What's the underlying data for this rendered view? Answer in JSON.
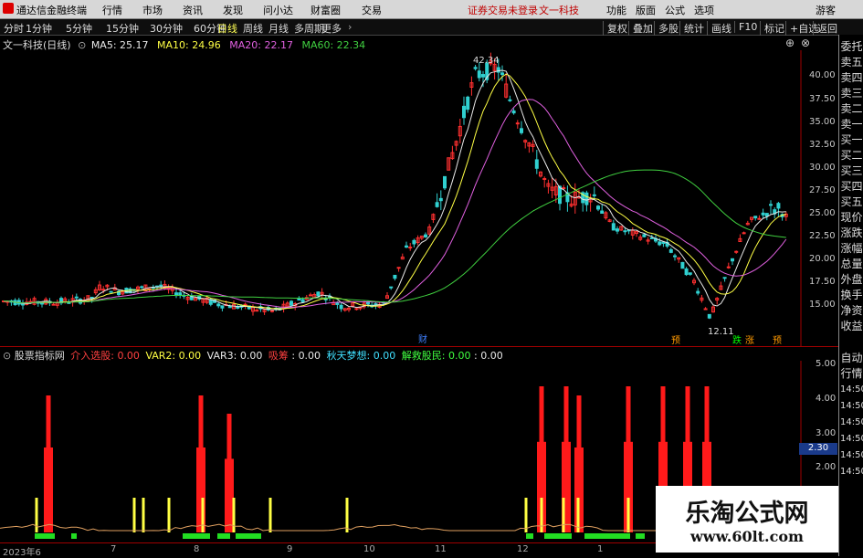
{
  "menu": {
    "app_name": "通达信金融终端",
    "items": [
      "行情",
      "市场",
      "资讯",
      "发现",
      "问小达",
      "财富圈",
      "交易"
    ],
    "notice": "证券交易未登录",
    "stock_name": "文一科技",
    "right_items": [
      "功能",
      "版面",
      "公式",
      "选项",
      "游客"
    ]
  },
  "toolbar": {
    "periods": [
      "1分钟",
      "5分钟",
      "15分钟",
      "30分钟",
      "60分钟"
    ],
    "first": "分时",
    "active": "日线",
    "others": [
      "周线",
      "月线",
      "多周期",
      "更多"
    ],
    "right": [
      "复权",
      "叠加",
      "多股",
      "统计",
      "画线",
      "F10",
      "标记",
      "+自选",
      "返回"
    ]
  },
  "main_chart": {
    "title": "文一科技(日线)",
    "ma": [
      {
        "label": "MA5: 25.17",
        "color": "#e8e8e8"
      },
      {
        "label": "MA10: 24.96",
        "color": "#ffff44"
      },
      {
        "label": "MA20: 22.17",
        "color": "#e060e0"
      },
      {
        "label": "MA60: 22.34",
        "color": "#40d040"
      }
    ],
    "high_label": "42.34",
    "low_label": "12.11",
    "yticks": [
      "40.00",
      "37.50",
      "35.00",
      "32.50",
      "30.00",
      "27.50",
      "25.00",
      "22.50",
      "20.00",
      "17.50",
      "15.00"
    ],
    "markers": [
      {
        "text": "财",
        "color": "#4080ff"
      },
      {
        "text": "预",
        "color": "#ff9900"
      },
      {
        "text": "跌",
        "color": "#00ff00"
      },
      {
        "text": "涨",
        "color": "#ff9900"
      },
      {
        "text": "预",
        "color": "#ff9900"
      }
    ]
  },
  "indicator": {
    "name": "股票指标网",
    "items": [
      {
        "label": "介入选股:",
        "value": "0.00",
        "color": "#ff4040"
      },
      {
        "label": "VAR2:",
        "value": "0.00",
        "color": "#ffff44"
      },
      {
        "label": "VAR3:",
        "value": "0.00",
        "color": "#e8e8e8"
      },
      {
        "label": "吸筹",
        "value": "",
        "color": "#ff4040"
      },
      {
        "label": ":",
        "value": "0.00",
        "color": "#e8e8e8"
      },
      {
        "label": "秋天梦想:",
        "value": "0.00",
        "color": "#40e0ff"
      },
      {
        "label": "解救股民:",
        "value": "0.00",
        "color": "#40ff40"
      },
      {
        "label": ":",
        "value": "0.00",
        "color": "#e8e8e8"
      }
    ],
    "yticks": [
      "5.00",
      "4.00",
      "3.00",
      "2.00"
    ],
    "current_value": "2.30"
  },
  "sidebar": [
    "委托",
    "卖五",
    "卖四",
    "卖三",
    "卖二",
    "卖一",
    "买一",
    "买二",
    "买三",
    "买四",
    "买五",
    "现价",
    "涨跌",
    "涨幅",
    "总量",
    "外盘",
    "换手",
    "净资",
    "收益",
    "自动",
    "行情"
  ],
  "right_times": [
    "14:50",
    "14:50",
    "14:50",
    "14:50",
    "14:50",
    "14:50"
  ],
  "xaxis": [
    "2023年6",
    "7",
    "8",
    "9",
    "10",
    "11",
    "12",
    "1"
  ],
  "watermark": {
    "title": "乐淘公式网",
    "url": "www.60lt.com"
  },
  "colors": {
    "up": "#ff3030",
    "down": "#30d0d0",
    "ma5": "#e8e8e8",
    "ma10": "#ffff44",
    "ma20": "#e060e0",
    "ma60": "#40d040"
  }
}
